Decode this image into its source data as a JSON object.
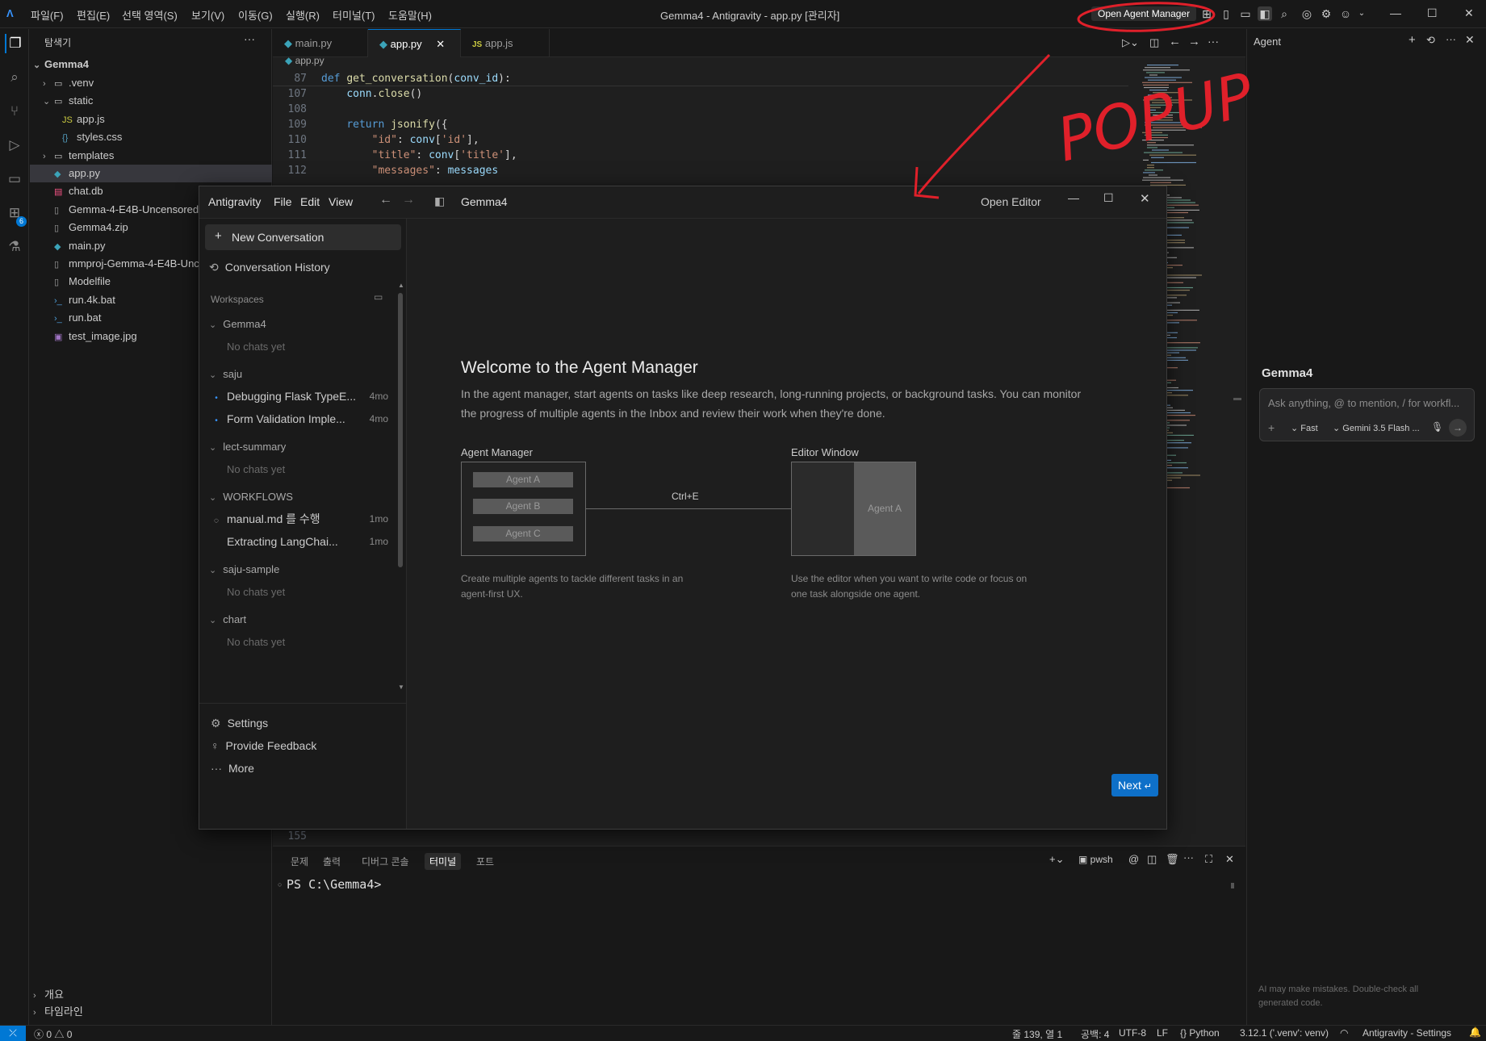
{
  "titlebar": {
    "menu": [
      "파일(F)",
      "편집(E)",
      "선택 영역(S)",
      "보기(V)",
      "이동(G)",
      "실행(R)",
      "터미널(T)",
      "도움말(H)"
    ],
    "title": "Gemma4 - Antigravity - app.py [관리자]",
    "open_agent_manager": "Open Agent Manager"
  },
  "explorer": {
    "header": "탐색기",
    "root": "Gemma4",
    "items": [
      {
        "label": ".venv",
        "type": "folder",
        "indent": 1
      },
      {
        "label": "static",
        "type": "folder-open",
        "indent": 1
      },
      {
        "label": "app.js",
        "type": "js",
        "indent": 2
      },
      {
        "label": "styles.css",
        "type": "css",
        "indent": 2
      },
      {
        "label": "templates",
        "type": "folder",
        "indent": 1
      },
      {
        "label": "app.py",
        "type": "py",
        "indent": 1,
        "selected": true
      },
      {
        "label": "chat.db",
        "type": "db",
        "indent": 1
      },
      {
        "label": "Gemma-4-E4B-Uncensored",
        "type": "file",
        "indent": 1
      },
      {
        "label": "Gemma4.zip",
        "type": "file",
        "indent": 1
      },
      {
        "label": "main.py",
        "type": "py",
        "indent": 1
      },
      {
        "label": "mmproj-Gemma-4-E4B-Unc",
        "type": "file",
        "indent": 1
      },
      {
        "label": "Modelfile",
        "type": "file",
        "indent": 1
      },
      {
        "label": "run.4k.bat",
        "type": "bat",
        "indent": 1
      },
      {
        "label": "run.bat",
        "type": "bat",
        "indent": 1
      },
      {
        "label": "test_image.jpg",
        "type": "img",
        "indent": 1
      }
    ],
    "outline": "개요",
    "timeline": "타임라인"
  },
  "tabs": [
    {
      "label": "main.py",
      "icon": "py",
      "active": false
    },
    {
      "label": "app.py",
      "icon": "py",
      "active": true
    },
    {
      "label": "app.js",
      "icon": "js",
      "active": false
    }
  ],
  "breadcrumb": "app.py",
  "code": {
    "sticky_line": "87",
    "sticky_text": "def get_conversation(conv_id):",
    "lines": [
      {
        "n": "107",
        "text": "    conn.close()"
      },
      {
        "n": "108",
        "text": ""
      },
      {
        "n": "109",
        "text": "    return jsonify({"
      },
      {
        "n": "110",
        "text": "        \"id\": conv['id'],"
      },
      {
        "n": "111",
        "text": "        \"title\": conv['title'],"
      },
      {
        "n": "112",
        "text": "        \"messages\": messages"
      }
    ],
    "last_line": "155"
  },
  "panel": {
    "tabs": [
      "문제",
      "출력",
      "디버그 콘솔",
      "터미널",
      "포트"
    ],
    "active_tab": "터미널",
    "shell": "pwsh",
    "prompt": "PS C:\\Gemma4>"
  },
  "agent_panel": {
    "title": "Agent",
    "workspace": "Gemma4",
    "placeholder": "Ask anything, @ to mention, / for workfl...",
    "mode": "Fast",
    "model": "Gemini 3.5 Flash ...",
    "disclaimer": "AI may make mistakes. Double-check all generated code."
  },
  "statusbar": {
    "errors": "0",
    "warnings": "0",
    "position": "줄 139, 열 1",
    "spaces": "공백: 4",
    "encoding": "UTF-8",
    "eol": "LF",
    "language": "Python",
    "interpreter": "3.12.1 ('.venv': venv)",
    "settings": "Antigravity - Settings"
  },
  "popup": {
    "menu": [
      "Antigravity",
      "File",
      "Edit",
      "View"
    ],
    "workspace": "Gemma4",
    "open_editor": "Open Editor",
    "new_conversation": "New Conversation",
    "history": "Conversation History",
    "workspaces_label": "Workspaces",
    "groups": [
      {
        "name": "Gemma4",
        "items": [
          {
            "label": "No chats yet",
            "muted": true
          }
        ]
      },
      {
        "name": "saju",
        "items": [
          {
            "label": "Debugging Flask TypeE...",
            "meta": "4mo",
            "dot": true
          },
          {
            "label": "Form Validation Imple...",
            "meta": "4mo",
            "dot": true
          }
        ]
      },
      {
        "name": "lect-summary",
        "items": [
          {
            "label": "No chats yet",
            "muted": true
          }
        ]
      },
      {
        "name": "WORKFLOWS",
        "items": [
          {
            "label": "manual.md 를 수행",
            "meta": "1mo",
            "spinner": true
          },
          {
            "label": "Extracting LangChai...",
            "meta": "1mo"
          }
        ]
      },
      {
        "name": "saju-sample",
        "items": [
          {
            "label": "No chats yet",
            "muted": true
          }
        ]
      },
      {
        "name": "chart",
        "items": [
          {
            "label": "No chats yet",
            "muted": true
          }
        ]
      }
    ],
    "settings": "Settings",
    "feedback": "Provide Feedback",
    "more": "More",
    "welcome": {
      "heading": "Welcome to the Agent Manager",
      "body": "In the agent manager, start agents on tasks like deep research, long-running projects, or background tasks. You can monitor the progress of multiple agents in the Inbox and review their work when they're done.",
      "manager_label": "Agent Manager",
      "agents": [
        "Agent A",
        "Agent B",
        "Agent C"
      ],
      "shortcut": "Ctrl+E",
      "editor_label": "Editor Window",
      "editor_agent": "Agent A",
      "manager_caption": "Create multiple agents to tackle different tasks in an agent-first UX.",
      "editor_caption": "Use the editor when you want to write code or focus on one task alongside one agent.",
      "next": "Next"
    }
  },
  "annotation": {
    "text": "POPUP",
    "color": "#e0202a"
  }
}
